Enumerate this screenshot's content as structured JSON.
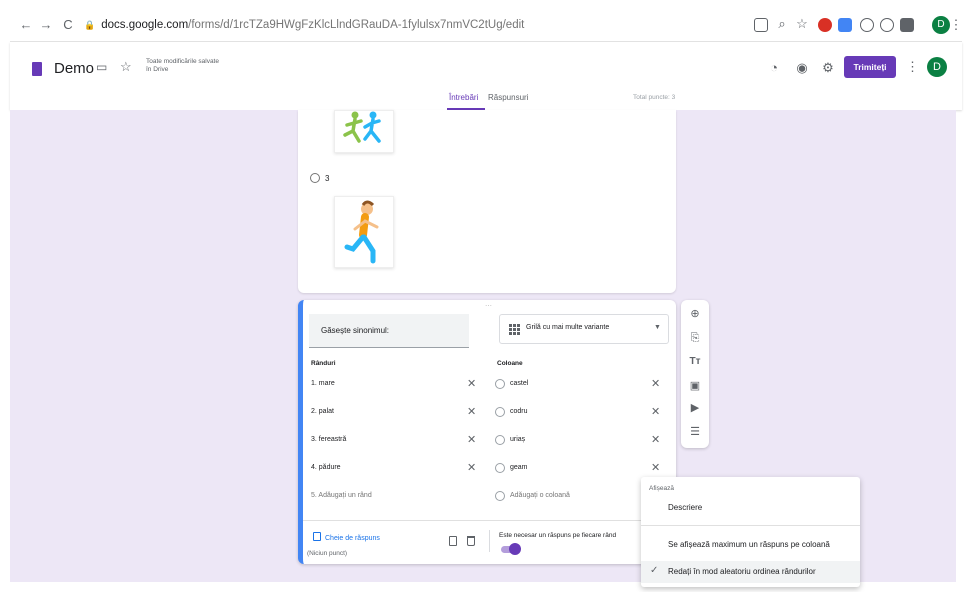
{
  "browser": {
    "back": "←",
    "forward": "→",
    "reload": "C",
    "url_host": "docs.google.com",
    "url_path": "/forms/d/1rcTZa9HWgFzKlcLlndGRauDA-1fylulsx7nmVC2tUg/edit",
    "avatar_letter": "D"
  },
  "header": {
    "title": "Demo",
    "save_status": "Toate modificările salvate în Drive",
    "send_label": "Trimiteți",
    "avatar_letter": "D",
    "tabs": [
      "Întrebări",
      "Răspunsuri"
    ],
    "total_points": "Total puncte: 3"
  },
  "question_above": {
    "option_label": "3"
  },
  "question": {
    "title": "Găsește sinonimul:",
    "type": "Grilă cu mai multe variante",
    "rows_header": "Rânduri",
    "columns_header": "Coloane",
    "rows": [
      "1. mare",
      "2. palat",
      "3. fereastră",
      "4. pădure"
    ],
    "add_row": "5. Adăugați un rând",
    "columns": [
      "castel",
      "codru",
      "uriaș",
      "geam"
    ],
    "add_column": "Adăugați o coloană",
    "answer_key": "Cheie de răspuns",
    "points": "(Niciun punct)",
    "required_label": "Este necesar un răspuns pe fiecare rând"
  },
  "menu": {
    "header": "Afișează",
    "items": [
      "Descriere",
      "Se afișează maximum un răspuns pe coloană",
      "Redați în mod aleatoriu ordinea rândurilor"
    ],
    "checked_index": 2
  },
  "colors": {
    "accent": "#673ab7",
    "canvas": "#ede7f6",
    "focus_border": "#4285f4"
  }
}
